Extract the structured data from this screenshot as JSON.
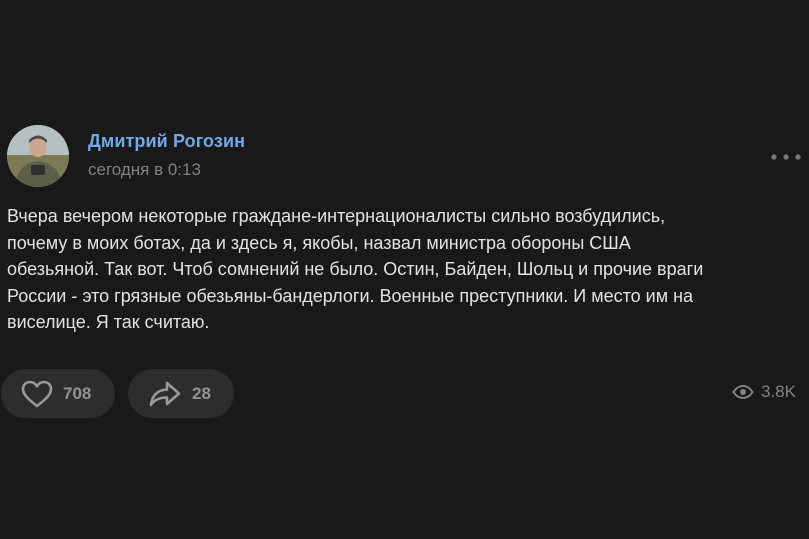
{
  "post": {
    "author": "Дмитрий Рогозин",
    "time": "сегодня в 0:13",
    "text": "Вчера вечером некоторые граждане-интернационалисты сильно возбудились,\nпочему в моих ботах, да и здесь я, якобы, назвал министра обороны США\nобезьяной. Так вот. Чтоб сомнений не было. Остин, Байден, Шольц и прочие враги\nРоссии - это грязные обезьяны-бандерлоги. Военные преступники. И место им на\nвиселице. Я так считаю.",
    "likes": "708",
    "shares": "28",
    "views": "3.8K"
  },
  "icons": {
    "like": "heart-icon",
    "share": "share-arrow-icon",
    "views": "eye-icon",
    "more": "more-dots-icon"
  },
  "colors": {
    "background": "#19191a",
    "author_link": "#71aaeb",
    "text": "#e1e3e6",
    "muted": "#828282",
    "pill": "#2c2d2e"
  }
}
